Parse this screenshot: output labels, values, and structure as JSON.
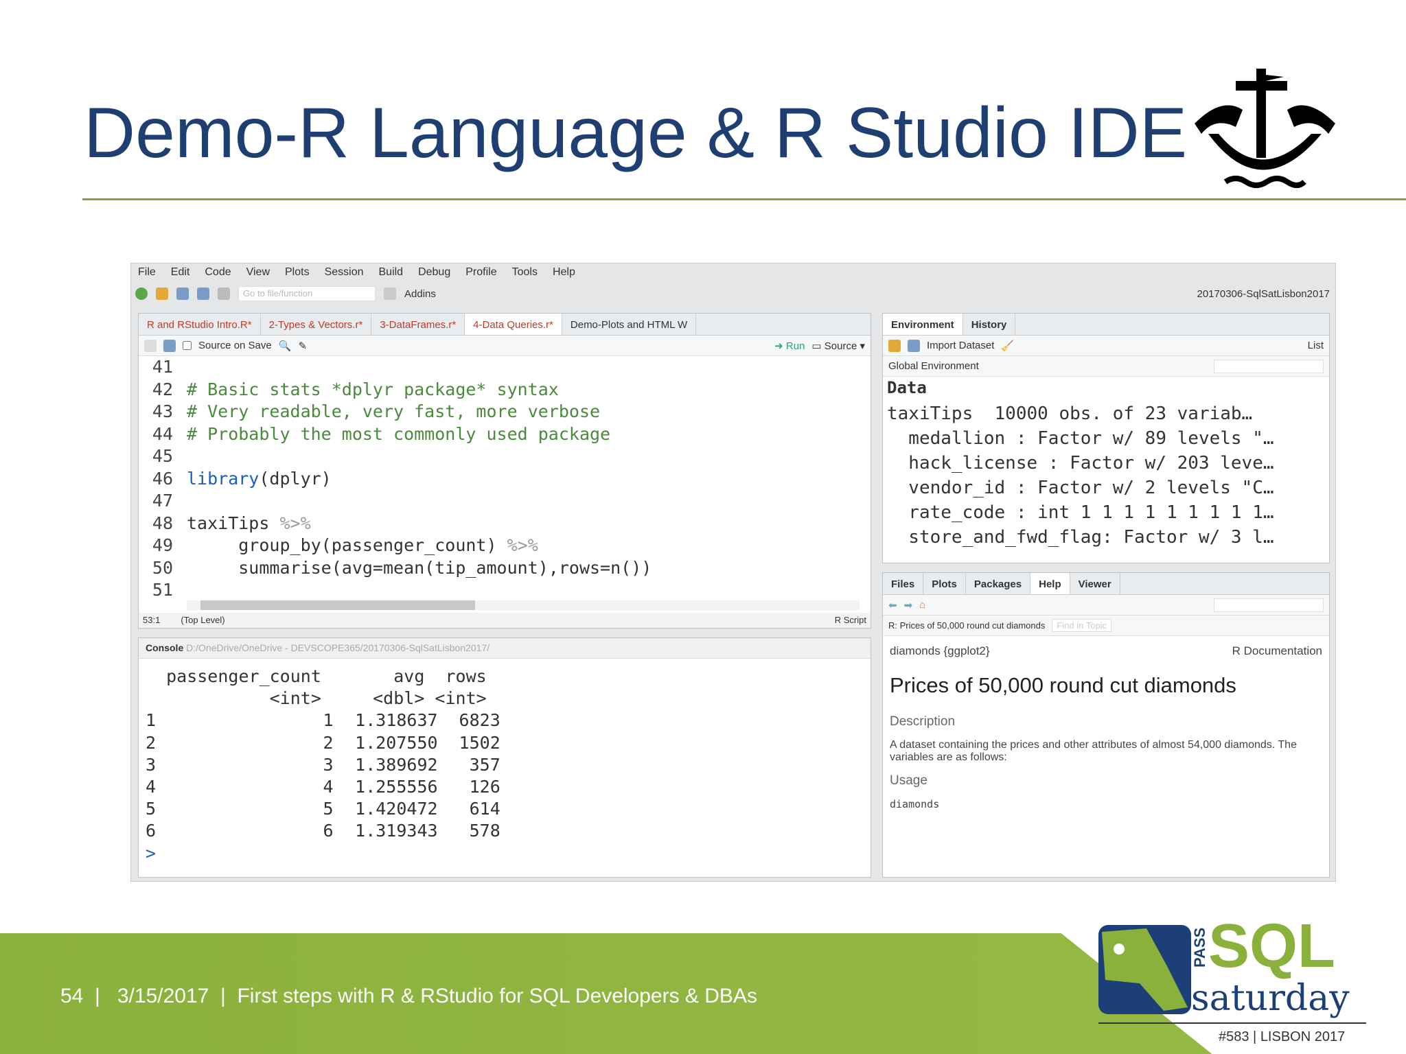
{
  "slide": {
    "title": "Demo-R Language & R Studio IDE",
    "page": "54",
    "date": "3/15/2017",
    "footer_title": "First steps with R & RStudio for SQL Developers & DBAs",
    "separator": "|"
  },
  "logo": {
    "text_pass": "PASS",
    "text_sql": "SQL",
    "text_saturday": "saturday",
    "event": "#583",
    "city": "LISBON 2017"
  },
  "colors": {
    "title": "#1f3f73",
    "green": "#8bb13d",
    "navy": "#1d3f78"
  },
  "ide": {
    "menu": [
      "File",
      "Edit",
      "Code",
      "View",
      "Plots",
      "Session",
      "Build",
      "Debug",
      "Profile",
      "Tools",
      "Help"
    ],
    "toolbar": {
      "goto_placeholder": "Go to file/function",
      "addins": "Addins",
      "project": "20170306-SqlSatLisbon2017"
    },
    "editor": {
      "tabs": [
        "R and RStudio Intro.R*",
        "2-Types & Vectors.r*",
        "3-DataFrames.r*",
        "4-Data Queries.r*",
        "Demo-Plots and HTML W"
      ],
      "active_tab": 3,
      "source_on_save": "Source on Save",
      "run": "Run",
      "source": "Source",
      "lines": [
        {
          "n": "41",
          "t": ""
        },
        {
          "n": "42",
          "t": "# Basic stats *dplyr package* syntax",
          "cls": "cm"
        },
        {
          "n": "43",
          "t": "# Very readable, very fast, more verbose",
          "cls": "cm"
        },
        {
          "n": "44",
          "t": "# Probably the most commonly used package",
          "cls": "cm"
        },
        {
          "n": "45",
          "t": ""
        },
        {
          "n": "46",
          "t": "library(dplyr)"
        },
        {
          "n": "47",
          "t": ""
        },
        {
          "n": "48",
          "t": "taxiTips %>%"
        },
        {
          "n": "49",
          "t": "     group_by(passenger_count) %>%"
        },
        {
          "n": "50",
          "t": "     summarise(avg=mean(tip_amount),rows=n())"
        },
        {
          "n": "51",
          "t": ""
        }
      ],
      "status_pos": "53:1",
      "status_scope": "(Top Level)",
      "status_type": "R Script"
    },
    "console": {
      "label": "Console",
      "path": "D:/OneDrive/OneDrive - DEVSCOPE365/20170306-SqlSatLisbon2017/",
      "header": "  passenger_count       avg  rows",
      "types": "            <int>     <dbl> <int>",
      "rows": [
        {
          "i": "1",
          "pc": "1",
          "avg": "1.318637",
          "rows": "6823"
        },
        {
          "i": "2",
          "pc": "2",
          "avg": "1.207550",
          "rows": "1502"
        },
        {
          "i": "3",
          "pc": "3",
          "avg": "1.389692",
          "rows": "357"
        },
        {
          "i": "4",
          "pc": "4",
          "avg": "1.255556",
          "rows": "126"
        },
        {
          "i": "5",
          "pc": "5",
          "avg": "1.420472",
          "rows": "614"
        },
        {
          "i": "6",
          "pc": "6",
          "avg": "1.319343",
          "rows": "578"
        }
      ],
      "prompt": ">"
    },
    "environment": {
      "tabs": [
        "Environment",
        "History"
      ],
      "import": "Import Dataset",
      "view": "List",
      "scope": "Global Environment",
      "section": "Data",
      "items": [
        "taxiTips  10000 obs. of 23 variab…",
        "  medallion : Factor w/ 89 levels \"…",
        "  hack_license : Factor w/ 203 leve…",
        "  vendor_id : Factor w/ 2 levels \"C…",
        "  rate_code : int 1 1 1 1 1 1 1 1 1…",
        "  store_and_fwd_flag: Factor w/ 3 l…"
      ]
    },
    "help": {
      "tabs": [
        "Files",
        "Plots",
        "Packages",
        "Help",
        "Viewer"
      ],
      "active_tab": 3,
      "topic": "R: Prices of 50,000 round cut diamonds",
      "find_placeholder": "Find in Topic",
      "pkg": "diamonds {ggplot2}",
      "rdoc": "R Documentation",
      "heading": "Prices of 50,000 round cut diamonds",
      "desc_h": "Description",
      "desc": "A dataset containing the prices and other attributes of almost 54,000 diamonds. The variables are as follows:",
      "usage_h": "Usage",
      "usage": "diamonds"
    }
  }
}
